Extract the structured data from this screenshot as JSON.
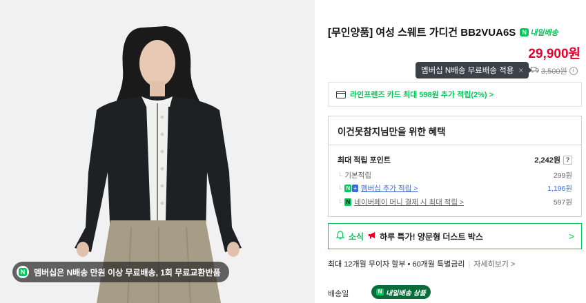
{
  "product": {
    "title": "[무인양품] 여성 스웨트 가디건 BB2VUA6S",
    "nextday_badge": "내일배송",
    "price": "29,900원",
    "tooltip": "멤버십 N배송 무료배송 적용",
    "tooltip_close": "×",
    "shipping_fee": "3,500원",
    "image_badge": "멤버십은 N배송 만원 이상 무료배송, 1회 무료교환반품"
  },
  "card_promo": "라인프렌즈 카드 최대 598원 추가 적립(2%) >",
  "benefit": {
    "heading": "이건못참지님만을 위한 혜택",
    "max_label": "최대 적립 포인트",
    "max_value": "2,242원",
    "help": "?",
    "rows": [
      {
        "label": "기본적립",
        "value": "299원"
      },
      {
        "label": "멤버십 추가 적립 >",
        "value": "1,196원"
      },
      {
        "label": "네이버페이 머니 결제 시 최대 적립 >",
        "value": "597원"
      }
    ]
  },
  "notice": {
    "tag": "소식",
    "text": "하루 특가! 양문형 더스트 박스",
    "chevron": ">"
  },
  "installment": {
    "text": "최대 12개월 무이자 할부 • 60개월 특별금리",
    "more": "자세히보기 >"
  },
  "delivery": {
    "label": "배송일",
    "chip": "내일배송 상품"
  },
  "colors": {
    "naver_green": "#03c75a",
    "price_red": "#e4002b",
    "membership_blue": "#3d6bd1"
  }
}
